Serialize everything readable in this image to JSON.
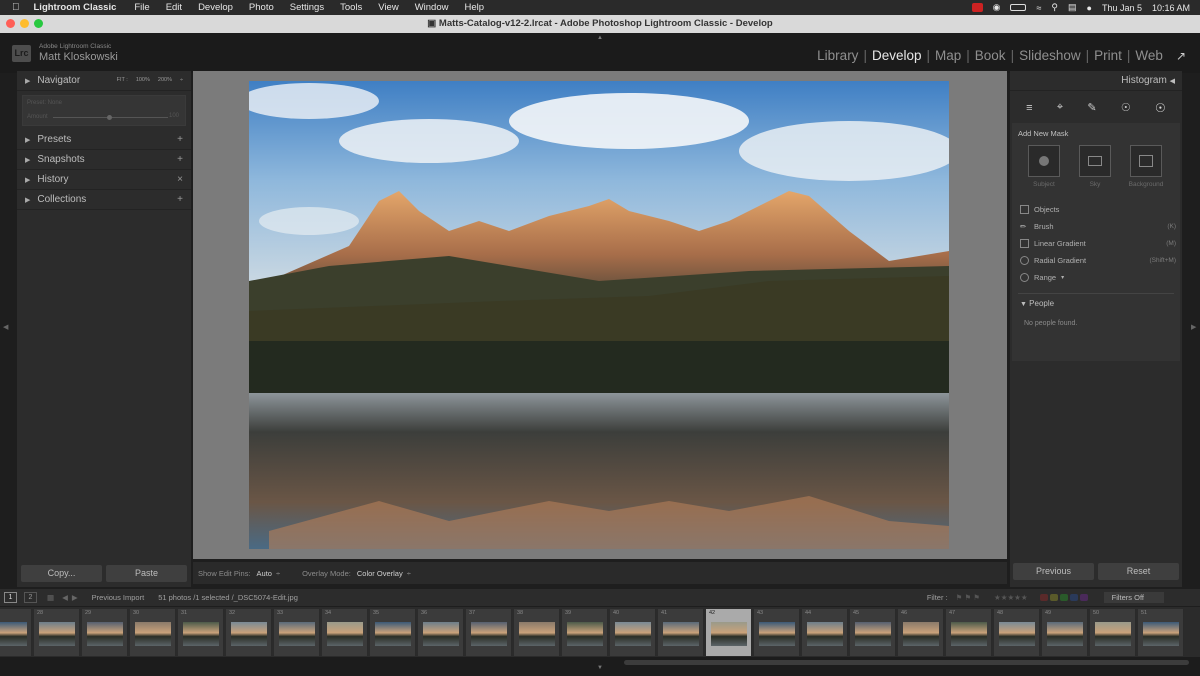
{
  "menubar": {
    "app": "Lightroom Classic",
    "items": [
      "File",
      "Edit",
      "Develop",
      "Photo",
      "Settings",
      "Tools",
      "View",
      "Window",
      "Help"
    ],
    "date": "Thu Jan 5",
    "time": "10:16 AM"
  },
  "window": {
    "title": "Matts-Catalog-v12-2.lrcat - Adobe Photoshop Lightroom Classic - Develop"
  },
  "identity": {
    "logo": "Lrc",
    "app_name": "Adobe Lightroom Classic",
    "user": "Matt Kloskowski"
  },
  "modules": [
    "Library",
    "Develop",
    "Map",
    "Book",
    "Slideshow",
    "Print",
    "Web"
  ],
  "active_module": "Develop",
  "left_panel": {
    "navigator": {
      "title": "Navigator",
      "zoom": [
        "FIT :",
        "100%",
        "200%",
        "÷"
      ],
      "preset_text": "Preset: None",
      "amount_label": "Amount",
      "amount_value": "100"
    },
    "sections": [
      {
        "label": "Presets",
        "action": "+"
      },
      {
        "label": "Snapshots",
        "action": "+"
      },
      {
        "label": "History",
        "action": "×"
      },
      {
        "label": "Collections",
        "action": "+"
      }
    ],
    "copy": "Copy...",
    "paste": "Paste"
  },
  "toolbar": {
    "pins_label": "Show Edit Pins:",
    "pins_value": "Auto",
    "overlay_label": "Overlay Mode:",
    "overlay_value": "Color Overlay"
  },
  "right_panel": {
    "histogram": "Histogram",
    "tools": [
      "sliders-icon",
      "crop-icon",
      "healing-icon",
      "redeye-icon",
      "masking-icon"
    ],
    "add_new_mask": "Add New Mask",
    "mask_buttons": [
      {
        "label": "Subject"
      },
      {
        "label": "Sky"
      },
      {
        "label": "Background"
      }
    ],
    "mask_items": [
      {
        "label": "Objects",
        "key": ""
      },
      {
        "label": "Brush",
        "key": "(K)"
      },
      {
        "label": "Linear Gradient",
        "key": "(M)"
      },
      {
        "label": "Radial Gradient",
        "key": "(Shift+M)"
      },
      {
        "label": "Range",
        "key": ""
      }
    ],
    "people_title": "People",
    "people_empty": "No people found.",
    "previous": "Previous",
    "reset": "Reset"
  },
  "filmstrip": {
    "pages": [
      "1",
      "2"
    ],
    "source": "Previous Import",
    "info": "51 photos /1 selected /_DSC5074-Edit.jpg",
    "filter_label": "Filter :",
    "filter_value": "Filters Off",
    "numbers": [
      "",
      "28",
      "29",
      "30",
      "31",
      "32",
      "33",
      "34",
      "35",
      "36",
      "37",
      "38",
      "39",
      "40",
      "41",
      "42",
      "43",
      "44",
      "45",
      "46",
      "47",
      "48",
      "49",
      "50",
      "51"
    ],
    "selected": "42"
  },
  "colors": {
    "panel": "#2c2c2c",
    "canvas": "#7b7b7b",
    "accent": "#e8e8e8"
  }
}
